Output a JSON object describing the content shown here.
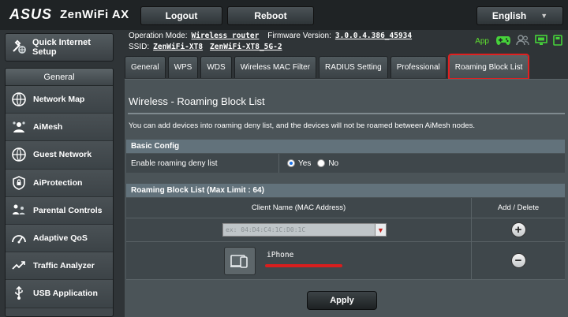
{
  "brand": {
    "logo": "ASUS",
    "model": "ZenWiFi AX"
  },
  "header": {
    "logout_label": "Logout",
    "reboot_label": "Reboot",
    "language": "English"
  },
  "status": {
    "op_mode_label": "Operation Mode:",
    "op_mode_value": "Wireless router",
    "firmware_label": "Firmware Version:",
    "firmware_value": "3.0.0.4.386_45934",
    "ssid_label": "SSID:",
    "ssid_1": "ZenWiFi-XT8",
    "ssid_2": "ZenWiFi-XT8_5G-2",
    "app_label": "App",
    "icons": [
      "gamepad-icon",
      "users-icon",
      "monitor-icon",
      "usb-icon"
    ],
    "app_color": "#5fe030"
  },
  "sidebar": {
    "quick_setup_label": "Quick Internet Setup",
    "general_label": "General",
    "items": [
      {
        "label": "Network Map",
        "icon": "network-map-icon"
      },
      {
        "label": "AiMesh",
        "icon": "aimesh-icon"
      },
      {
        "label": "Guest Network",
        "icon": "guest-network-icon"
      },
      {
        "label": "AiProtection",
        "icon": "aiprotection-icon"
      },
      {
        "label": "Parental Controls",
        "icon": "parental-controls-icon"
      },
      {
        "label": "Adaptive QoS",
        "icon": "adaptive-qos-icon"
      },
      {
        "label": "Traffic Analyzer",
        "icon": "traffic-analyzer-icon"
      },
      {
        "label": "USB Application",
        "icon": "usb-application-icon"
      }
    ]
  },
  "tabs": [
    {
      "label": "General"
    },
    {
      "label": "WPS"
    },
    {
      "label": "WDS"
    },
    {
      "label": "Wireless MAC Filter"
    },
    {
      "label": "RADIUS Setting"
    },
    {
      "label": "Professional"
    },
    {
      "label": "Roaming Block List",
      "active": true
    }
  ],
  "main": {
    "title": "Wireless - Roaming Block List",
    "description": "You can add devices into roaming deny list, and the devices will not be roamed between AiMesh nodes.",
    "basic_config": {
      "header": "Basic Config",
      "enable_label": "Enable roaming deny list",
      "options": [
        "Yes",
        "No"
      ],
      "selected": "Yes"
    },
    "block_list": {
      "header": "Roaming Block List (Max Limit : 64)",
      "col_client": "Client Name (MAC Address)",
      "col_action": "Add / Delete",
      "mac_placeholder": "ex: 04:D4:C4:1C:D0:1C",
      "add_symbol": "+",
      "delete_symbol": "−",
      "entries": [
        {
          "name": "iPhone"
        }
      ]
    },
    "apply_label": "Apply"
  },
  "colors": {
    "highlight": "#e02020",
    "section_header": "#62727b",
    "panel": "#4b5458"
  }
}
